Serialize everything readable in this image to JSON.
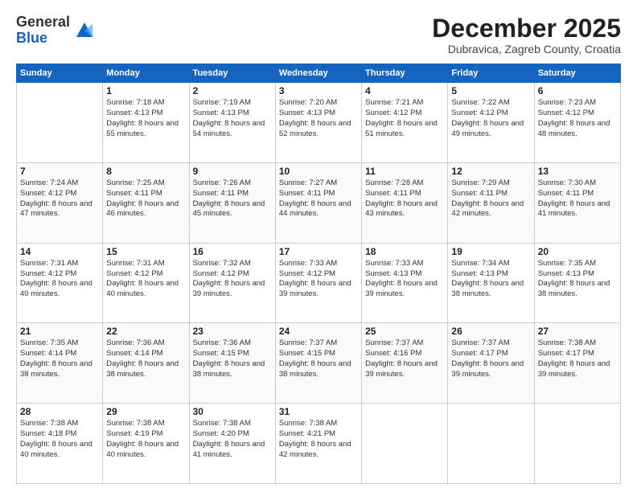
{
  "header": {
    "logo_general": "General",
    "logo_blue": "Blue",
    "month_title": "December 2025",
    "location": "Dubravica, Zagreb County, Croatia"
  },
  "days_of_week": [
    "Sunday",
    "Monday",
    "Tuesday",
    "Wednesday",
    "Thursday",
    "Friday",
    "Saturday"
  ],
  "weeks": [
    [
      {
        "day": "",
        "sunrise": "",
        "sunset": "",
        "daylight": ""
      },
      {
        "day": "1",
        "sunrise": "Sunrise: 7:18 AM",
        "sunset": "Sunset: 4:13 PM",
        "daylight": "Daylight: 8 hours and 55 minutes."
      },
      {
        "day": "2",
        "sunrise": "Sunrise: 7:19 AM",
        "sunset": "Sunset: 4:13 PM",
        "daylight": "Daylight: 8 hours and 54 minutes."
      },
      {
        "day": "3",
        "sunrise": "Sunrise: 7:20 AM",
        "sunset": "Sunset: 4:13 PM",
        "daylight": "Daylight: 8 hours and 52 minutes."
      },
      {
        "day": "4",
        "sunrise": "Sunrise: 7:21 AM",
        "sunset": "Sunset: 4:12 PM",
        "daylight": "Daylight: 8 hours and 51 minutes."
      },
      {
        "day": "5",
        "sunrise": "Sunrise: 7:22 AM",
        "sunset": "Sunset: 4:12 PM",
        "daylight": "Daylight: 8 hours and 49 minutes."
      },
      {
        "day": "6",
        "sunrise": "Sunrise: 7:23 AM",
        "sunset": "Sunset: 4:12 PM",
        "daylight": "Daylight: 8 hours and 48 minutes."
      }
    ],
    [
      {
        "day": "7",
        "sunrise": "Sunrise: 7:24 AM",
        "sunset": "Sunset: 4:12 PM",
        "daylight": "Daylight: 8 hours and 47 minutes."
      },
      {
        "day": "8",
        "sunrise": "Sunrise: 7:25 AM",
        "sunset": "Sunset: 4:11 PM",
        "daylight": "Daylight: 8 hours and 46 minutes."
      },
      {
        "day": "9",
        "sunrise": "Sunrise: 7:26 AM",
        "sunset": "Sunset: 4:11 PM",
        "daylight": "Daylight: 8 hours and 45 minutes."
      },
      {
        "day": "10",
        "sunrise": "Sunrise: 7:27 AM",
        "sunset": "Sunset: 4:11 PM",
        "daylight": "Daylight: 8 hours and 44 minutes."
      },
      {
        "day": "11",
        "sunrise": "Sunrise: 7:28 AM",
        "sunset": "Sunset: 4:11 PM",
        "daylight": "Daylight: 8 hours and 43 minutes."
      },
      {
        "day": "12",
        "sunrise": "Sunrise: 7:29 AM",
        "sunset": "Sunset: 4:11 PM",
        "daylight": "Daylight: 8 hours and 42 minutes."
      },
      {
        "day": "13",
        "sunrise": "Sunrise: 7:30 AM",
        "sunset": "Sunset: 4:11 PM",
        "daylight": "Daylight: 8 hours and 41 minutes."
      }
    ],
    [
      {
        "day": "14",
        "sunrise": "Sunrise: 7:31 AM",
        "sunset": "Sunset: 4:12 PM",
        "daylight": "Daylight: 8 hours and 40 minutes."
      },
      {
        "day": "15",
        "sunrise": "Sunrise: 7:31 AM",
        "sunset": "Sunset: 4:12 PM",
        "daylight": "Daylight: 8 hours and 40 minutes."
      },
      {
        "day": "16",
        "sunrise": "Sunrise: 7:32 AM",
        "sunset": "Sunset: 4:12 PM",
        "daylight": "Daylight: 8 hours and 39 minutes."
      },
      {
        "day": "17",
        "sunrise": "Sunrise: 7:33 AM",
        "sunset": "Sunset: 4:12 PM",
        "daylight": "Daylight: 8 hours and 39 minutes."
      },
      {
        "day": "18",
        "sunrise": "Sunrise: 7:33 AM",
        "sunset": "Sunset: 4:13 PM",
        "daylight": "Daylight: 8 hours and 39 minutes."
      },
      {
        "day": "19",
        "sunrise": "Sunrise: 7:34 AM",
        "sunset": "Sunset: 4:13 PM",
        "daylight": "Daylight: 8 hours and 38 minutes."
      },
      {
        "day": "20",
        "sunrise": "Sunrise: 7:35 AM",
        "sunset": "Sunset: 4:13 PM",
        "daylight": "Daylight: 8 hours and 38 minutes."
      }
    ],
    [
      {
        "day": "21",
        "sunrise": "Sunrise: 7:35 AM",
        "sunset": "Sunset: 4:14 PM",
        "daylight": "Daylight: 8 hours and 38 minutes."
      },
      {
        "day": "22",
        "sunrise": "Sunrise: 7:36 AM",
        "sunset": "Sunset: 4:14 PM",
        "daylight": "Daylight: 8 hours and 38 minutes."
      },
      {
        "day": "23",
        "sunrise": "Sunrise: 7:36 AM",
        "sunset": "Sunset: 4:15 PM",
        "daylight": "Daylight: 8 hours and 38 minutes."
      },
      {
        "day": "24",
        "sunrise": "Sunrise: 7:37 AM",
        "sunset": "Sunset: 4:15 PM",
        "daylight": "Daylight: 8 hours and 38 minutes."
      },
      {
        "day": "25",
        "sunrise": "Sunrise: 7:37 AM",
        "sunset": "Sunset: 4:16 PM",
        "daylight": "Daylight: 8 hours and 39 minutes."
      },
      {
        "day": "26",
        "sunrise": "Sunrise: 7:37 AM",
        "sunset": "Sunset: 4:17 PM",
        "daylight": "Daylight: 8 hours and 39 minutes."
      },
      {
        "day": "27",
        "sunrise": "Sunrise: 7:38 AM",
        "sunset": "Sunset: 4:17 PM",
        "daylight": "Daylight: 8 hours and 39 minutes."
      }
    ],
    [
      {
        "day": "28",
        "sunrise": "Sunrise: 7:38 AM",
        "sunset": "Sunset: 4:18 PM",
        "daylight": "Daylight: 8 hours and 40 minutes."
      },
      {
        "day": "29",
        "sunrise": "Sunrise: 7:38 AM",
        "sunset": "Sunset: 4:19 PM",
        "daylight": "Daylight: 8 hours and 40 minutes."
      },
      {
        "day": "30",
        "sunrise": "Sunrise: 7:38 AM",
        "sunset": "Sunset: 4:20 PM",
        "daylight": "Daylight: 8 hours and 41 minutes."
      },
      {
        "day": "31",
        "sunrise": "Sunrise: 7:38 AM",
        "sunset": "Sunset: 4:21 PM",
        "daylight": "Daylight: 8 hours and 42 minutes."
      },
      {
        "day": "",
        "sunrise": "",
        "sunset": "",
        "daylight": ""
      },
      {
        "day": "",
        "sunrise": "",
        "sunset": "",
        "daylight": ""
      },
      {
        "day": "",
        "sunrise": "",
        "sunset": "",
        "daylight": ""
      }
    ]
  ]
}
